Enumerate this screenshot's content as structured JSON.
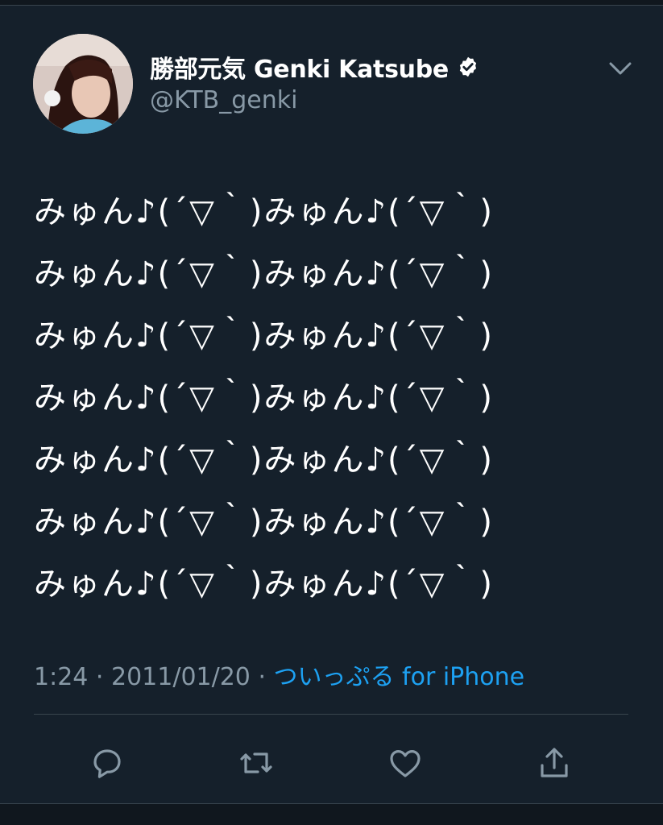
{
  "tweet": {
    "display_name": "勝部元気 Genki Katsube",
    "handle": "@KTB_genki",
    "verified_icon": "verified-badge-icon",
    "lines": [
      "みゅん♪(´▽｀)みゅん♪(´▽｀)",
      "みゅん♪(´▽｀)みゅん♪(´▽｀)",
      "みゅん♪(´▽｀)みゅん♪(´▽｀)",
      "みゅん♪(´▽｀)みゅん♪(´▽｀)",
      "みゅん♪(´▽｀)みゅん♪(´▽｀)",
      "みゅん♪(´▽｀)みゅん♪(´▽｀)",
      "みゅん♪(´▽｀)みゅん♪(´▽｀)"
    ],
    "time": "1:24",
    "date": "2011/01/20",
    "separator": " · ",
    "source": "ついっぷる for iPhone"
  },
  "actions": {
    "icons": [
      "reply-icon",
      "retweet-icon",
      "like-icon",
      "share-icon"
    ]
  },
  "colors": {
    "background": "#15202b",
    "text": "#ffffff",
    "muted": "#8899a6",
    "link": "#1da1f2",
    "divider": "#38444d"
  }
}
